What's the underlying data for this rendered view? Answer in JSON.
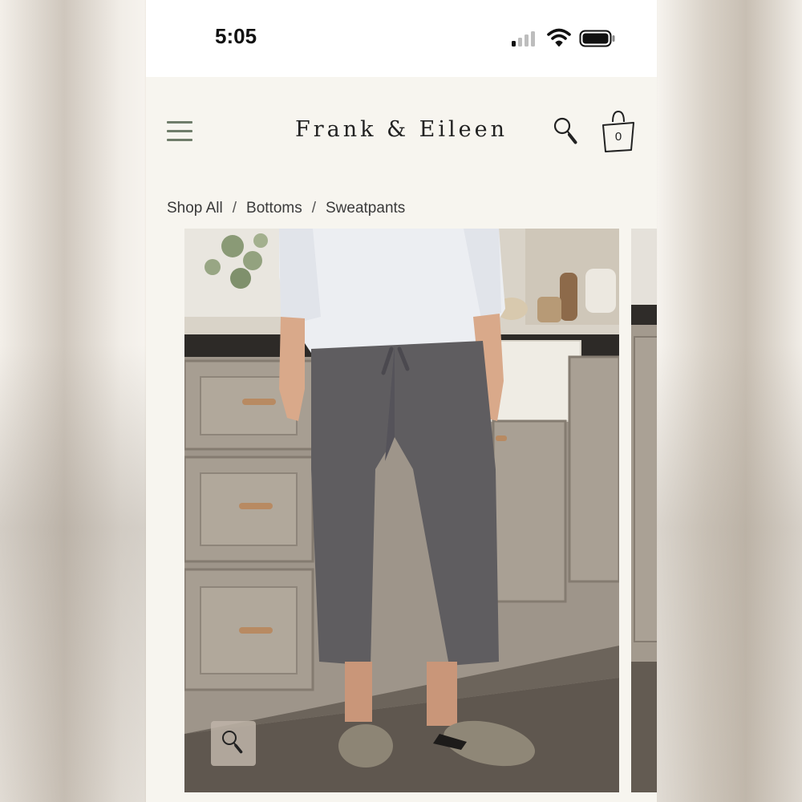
{
  "status_bar": {
    "time": "5:05"
  },
  "header": {
    "logo": "Frank & Eileen",
    "menu_icon": "hamburger-menu-icon",
    "search_icon": "magnifier-icon",
    "cart_icon": "shopping-bag-icon",
    "cart_count": "0"
  },
  "breadcrumb": {
    "items": [
      "Shop All",
      "Bottoms",
      "Sweatpants"
    ],
    "separator": "/"
  },
  "gallery": {
    "zoom_icon": "magnifier-icon"
  },
  "colors": {
    "page_background": "#f7f5ef",
    "menu_icon": "#6f7d6a",
    "text": "#222222",
    "pants": "#5f5d60"
  }
}
